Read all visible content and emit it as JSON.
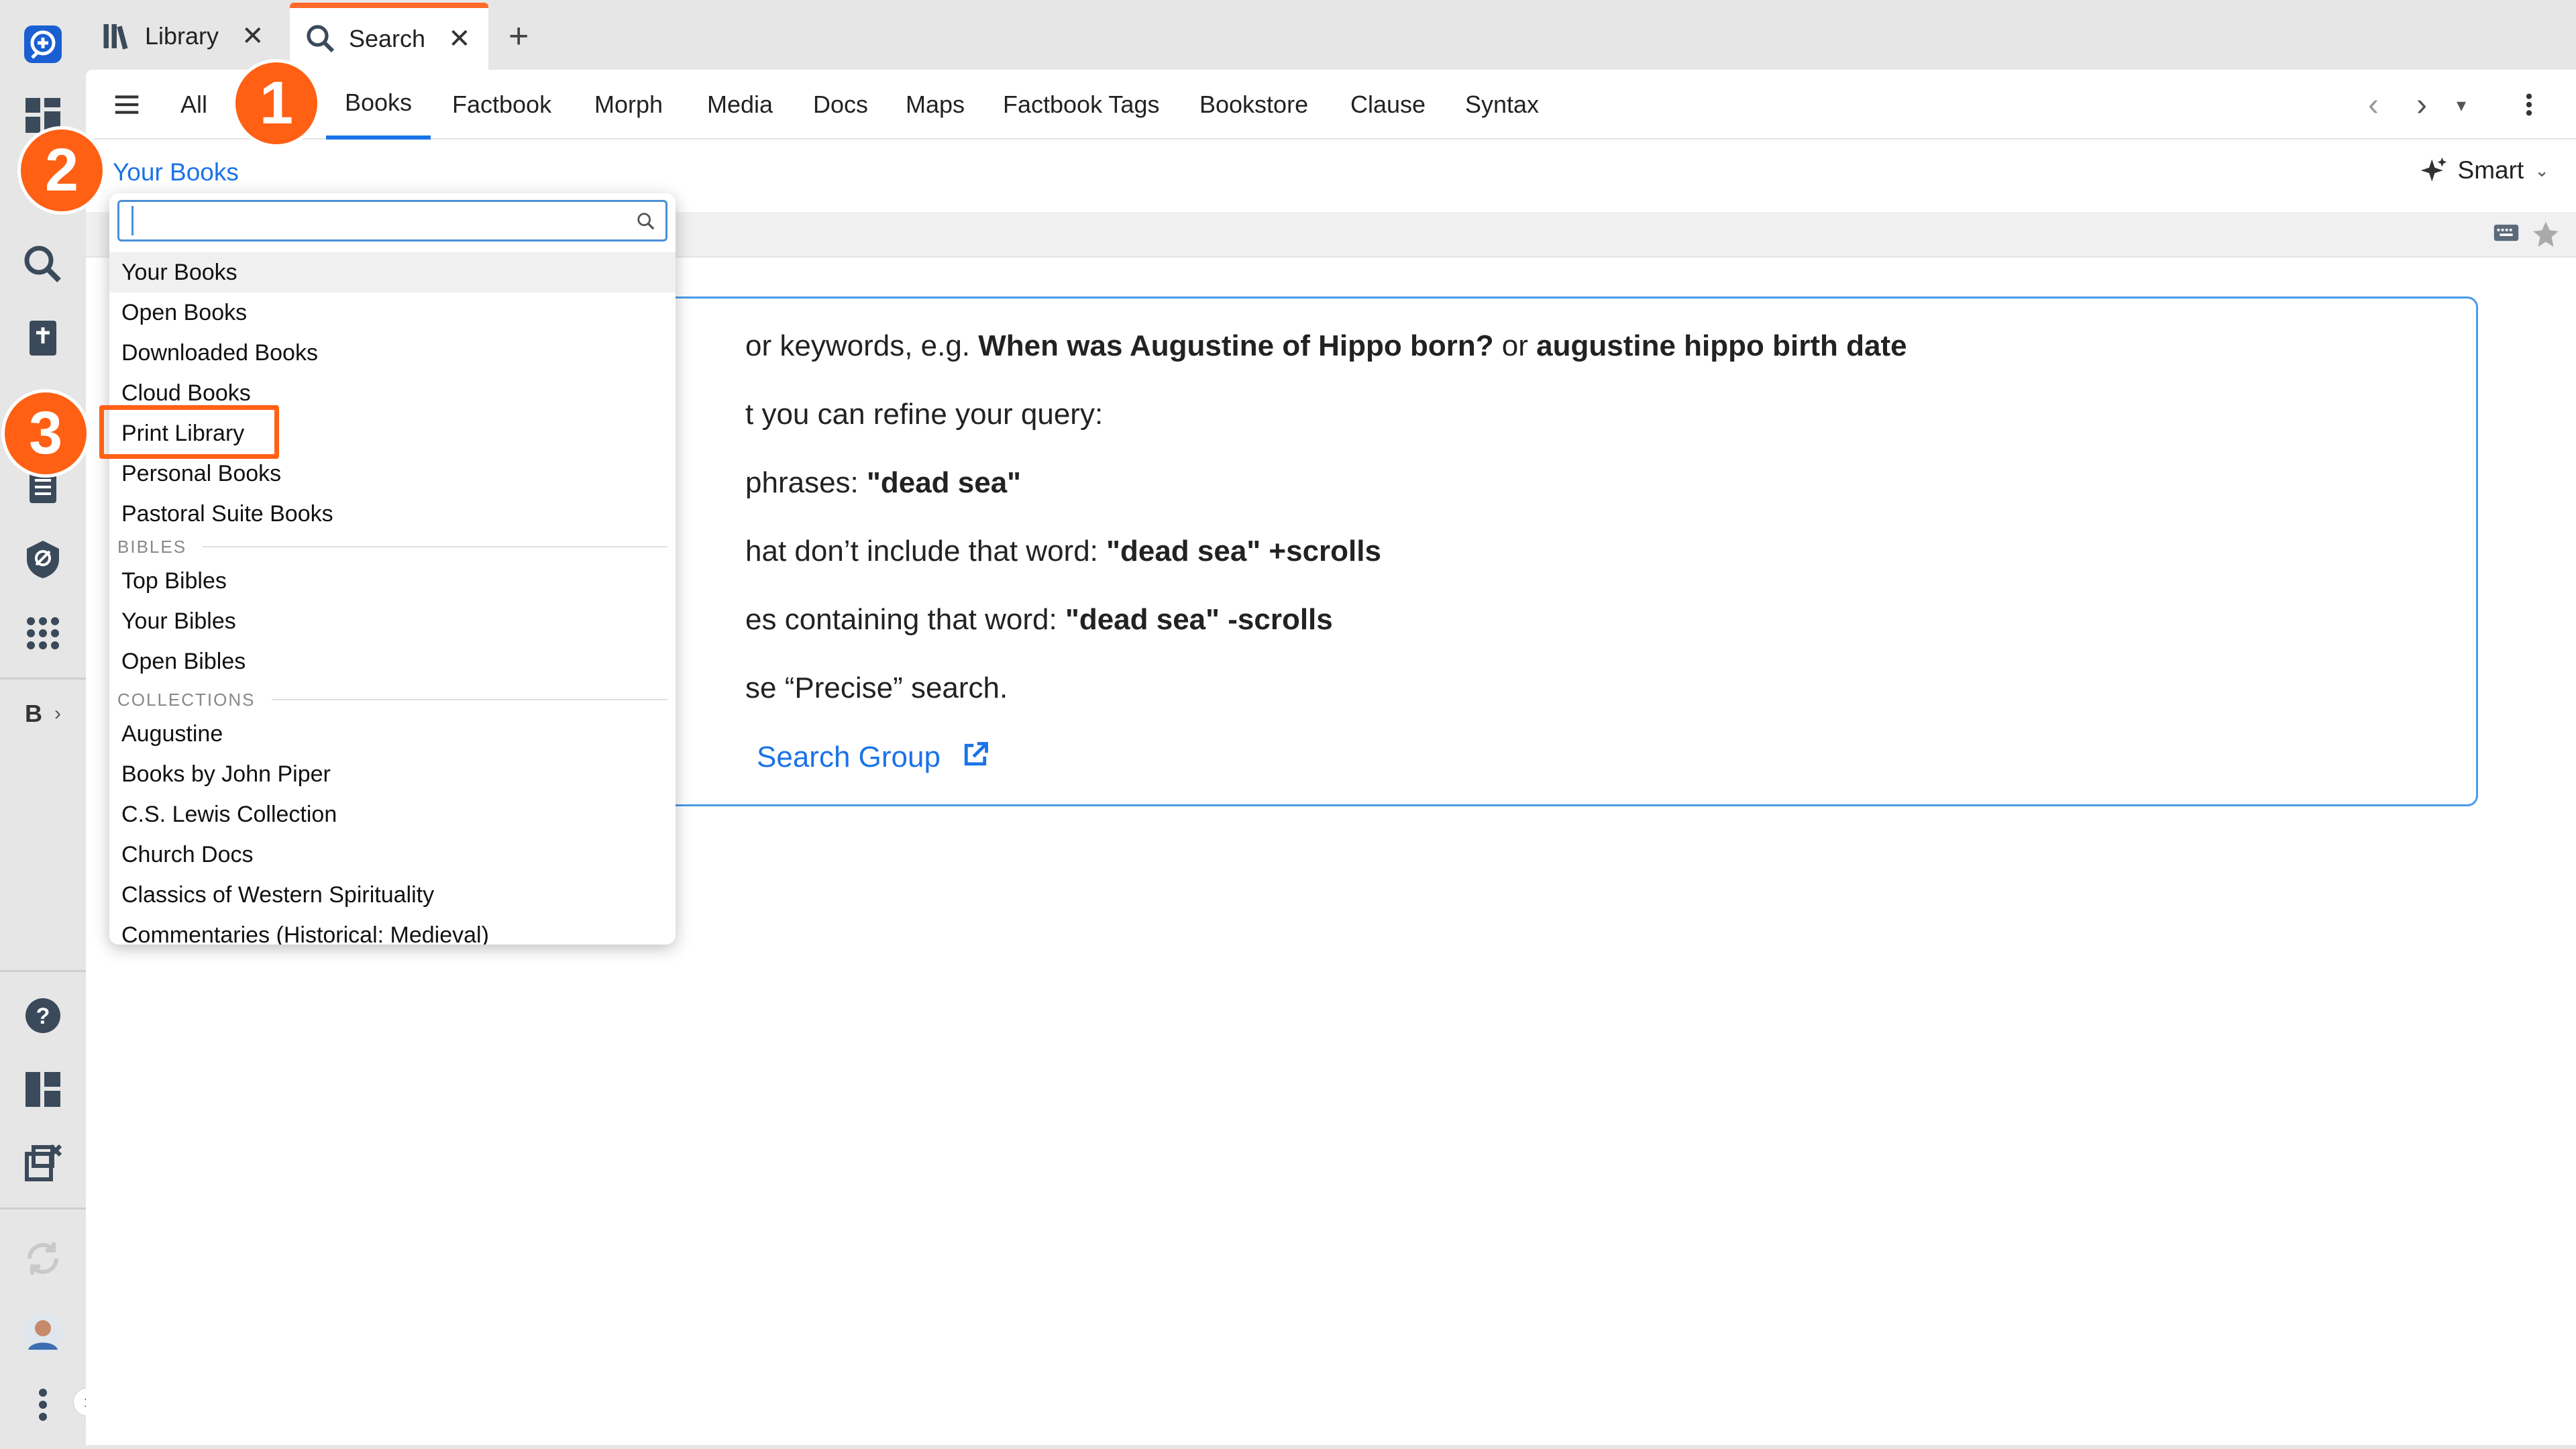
{
  "tabs": [
    {
      "label": "Library",
      "icon": "library-icon"
    },
    {
      "label": "Search",
      "icon": "search-icon"
    }
  ],
  "add_tab": "+",
  "close_glyph": "✕",
  "subtabs": [
    "All",
    "Books",
    "Factbook",
    "Morph",
    "Media",
    "Docs",
    "Maps",
    "Factbook Tags",
    "Bookstore",
    "Clause",
    "Syntax"
  ],
  "active_subtab": "Books",
  "scope_label": "Your Books",
  "smart_label": "Smart",
  "rail": {
    "b_label": "B"
  },
  "info": {
    "line1_pre": "or keywords, e.g. ",
    "line1_b1": "When was Augustine of Hippo born?",
    "line1_mid": " or ",
    "line1_b2": "augustine hippo birth date",
    "line2": "t you can refine your query:",
    "line3_pre": "phrases: ",
    "line3_b": "\"dead sea\"",
    "line4_pre": "hat don’t include that word: ",
    "line4_b": "\"dead sea\" +scrolls",
    "line5_pre": "es containing that word: ",
    "line5_b": "\"dead sea\" -scrolls",
    "line6": "se “Precise” search.",
    "link": "Search Group"
  },
  "dropdown": {
    "search_value": "",
    "items_top": [
      "Your Books",
      "Open Books",
      "Downloaded Books",
      "Cloud Books",
      "Print Library",
      "Personal Books",
      "Pastoral Suite Books"
    ],
    "section_bibles": "BIBLES",
    "items_bibles": [
      "Top Bibles",
      "Your Bibles",
      "Open Bibles"
    ],
    "section_collections": "COLLECTIONS",
    "items_collections": [
      "Augustine",
      "Books by John Piper",
      "C.S. Lewis Collection",
      "Church Docs",
      "Classics of Western Spirituality",
      "Commentaries (Historical: Medieval)"
    ]
  },
  "annotations": [
    "1",
    "2",
    "3"
  ],
  "colors": {
    "accent": "#1a73e8",
    "annotation": "#ff6014",
    "tab_highlight": "#ff6a2a"
  }
}
